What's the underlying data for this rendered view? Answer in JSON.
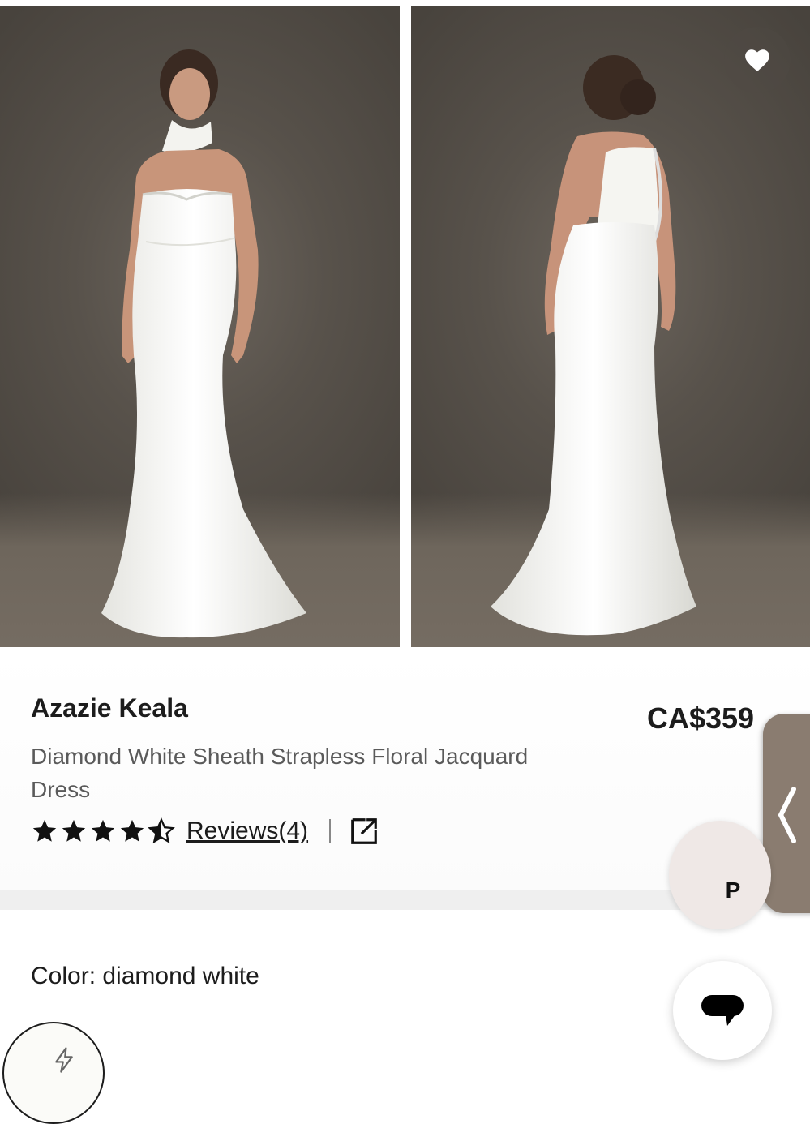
{
  "product": {
    "brand": "Azazie Keala",
    "price": "CA$359",
    "description": "Diamond White Sheath Strapless Floral Jacquard Dress",
    "rating": 4.5,
    "rating_max": 5,
    "reviews_label": "Reviews(4)"
  },
  "color": {
    "label": "Color: diamond white",
    "swatch_color": "#fbfbf8"
  },
  "floating": {
    "p_badge_label": "P"
  },
  "icons": {
    "wishlist": "heart-icon",
    "share": "external-link-icon",
    "side_tab": "chevron-left-icon",
    "chat": "chat-bubble-icon",
    "swatch": "lightning-bolt-icon"
  },
  "colors": {
    "text": "#1c1c1c",
    "muted_text": "#5a5a5a",
    "photo_backdrop": "#58524b",
    "side_tab": "#8a7c70"
  }
}
